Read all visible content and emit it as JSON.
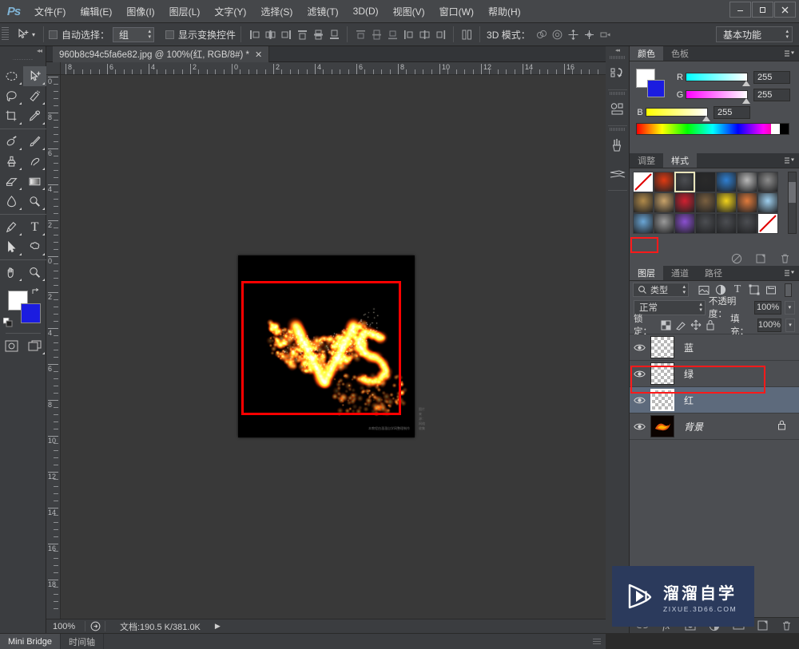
{
  "app": {
    "logo": "Ps",
    "menus": [
      {
        "label": "文件(F)"
      },
      {
        "label": "编辑(E)"
      },
      {
        "label": "图像(I)"
      },
      {
        "label": "图层(L)"
      },
      {
        "label": "文字(Y)"
      },
      {
        "label": "选择(S)"
      },
      {
        "label": "滤镜(T)"
      },
      {
        "label": "3D(D)"
      },
      {
        "label": "视图(V)"
      },
      {
        "label": "窗口(W)"
      },
      {
        "label": "帮助(H)"
      }
    ],
    "window_controls": {
      "minimize": "—",
      "maximize": "❐",
      "close": "✕"
    }
  },
  "options_bar": {
    "tool_icon": "move-tool-icon",
    "auto_select_label": "自动选择：",
    "auto_select_value": "组",
    "show_transform_label": "显示变换控件",
    "mode_3d_label": "3D 模式：",
    "workspace_value": "基本功能"
  },
  "toolbar": {
    "tools": [
      {
        "name": "marquee-tool",
        "glyph": "marquee"
      },
      {
        "name": "move-tool",
        "glyph": "move",
        "active": true
      },
      {
        "name": "lasso-tool",
        "glyph": "lasso"
      },
      {
        "name": "quick-selection-tool",
        "glyph": "quickselect"
      },
      {
        "name": "crop-tool",
        "glyph": "crop"
      },
      {
        "name": "eyedropper-tool",
        "glyph": "eyedropper"
      },
      {
        "name": "healing-brush-tool",
        "glyph": "heal"
      },
      {
        "name": "brush-tool",
        "glyph": "brush"
      },
      {
        "name": "clone-stamp-tool",
        "glyph": "stamp"
      },
      {
        "name": "history-brush-tool",
        "glyph": "historybrush"
      },
      {
        "name": "eraser-tool",
        "glyph": "eraser"
      },
      {
        "name": "gradient-tool",
        "glyph": "gradient"
      },
      {
        "name": "blur-tool",
        "glyph": "blur"
      },
      {
        "name": "dodge-tool",
        "glyph": "dodge"
      },
      {
        "name": "pen-tool",
        "glyph": "pen"
      },
      {
        "name": "type-tool",
        "glyph": "type"
      },
      {
        "name": "path-selection-tool",
        "glyph": "pathselect"
      },
      {
        "name": "shape-tool",
        "glyph": "shape"
      },
      {
        "name": "hand-tool",
        "glyph": "hand"
      },
      {
        "name": "zoom-tool",
        "glyph": "zoom"
      }
    ],
    "foreground_color": "#ffffff",
    "background_color": "#1b1ce0",
    "quick_mask_name": "quick-mask-button",
    "screen_mode_name": "screen-mode-button"
  },
  "document": {
    "tab_title": "960b8c94c5fa6e82.jpg @ 100%(红, RGB/8#) *",
    "close_glyph": "✕",
    "zoom_level": "100%",
    "ruler_h_labels": [
      "8",
      "6",
      "4",
      "2",
      "0",
      "2",
      "4",
      "6",
      "8",
      "10",
      "12",
      "14",
      "16"
    ],
    "ruler_v_labels": [
      "0",
      "8",
      "6",
      "4",
      "2",
      "0",
      "2",
      "4",
      "6",
      "8",
      "10",
      "12",
      "14",
      "16",
      "18"
    ],
    "credit_left": "图片来源：网络收集",
    "credit_right": "本教程由溜溜自学网整理制作"
  },
  "status_bar": {
    "zoom": "100%",
    "doc_label": "文档:190.5 K/381.0K",
    "arrow_glyph": "▶"
  },
  "bottom_tabs": [
    {
      "label": "Mini Bridge",
      "active": true
    },
    {
      "label": "时间轴",
      "active": false
    }
  ],
  "mini_dock": [
    {
      "name": "history-panel-icon"
    },
    {
      "name": "actions-panel-icon"
    },
    {
      "name": "brush-panel-icon"
    },
    {
      "name": "brush-presets-panel-icon"
    }
  ],
  "color_panel": {
    "tabs": [
      {
        "label": "颜色",
        "active": true
      },
      {
        "label": "色板",
        "active": false
      }
    ],
    "sliders": [
      {
        "label": "R",
        "value": "255"
      },
      {
        "label": "G",
        "value": "255"
      },
      {
        "label": "B",
        "value": "255"
      }
    ],
    "foreground": "#ffffff",
    "background": "#1b1ce0"
  },
  "styles_panel": {
    "tabs": [
      {
        "label": "调整",
        "active": false
      },
      {
        "label": "样式",
        "active": true
      }
    ],
    "swatches": [
      {
        "name": "style-none",
        "color": "none",
        "selected": false
      },
      {
        "name": "style-red-glow",
        "color": "#e03a12",
        "selected": false
      },
      {
        "name": "style-beveled",
        "color": "#4c4e52",
        "selected": true
      },
      {
        "name": "style-dark-metal",
        "color": "#2a2a2a",
        "selected": false
      },
      {
        "name": "style-blue-sky",
        "color": "#2f7fd1",
        "selected": false
      },
      {
        "name": "style-grey",
        "color": "#b9b9b9",
        "selected": false
      },
      {
        "name": "style-grey-glow",
        "color": "#8c8c8c",
        "selected": false
      },
      {
        "name": "style-tan",
        "color": "#b08a4a",
        "selected": false
      },
      {
        "name": "style-sand",
        "color": "#c8a269",
        "selected": false
      },
      {
        "name": "style-red-stripes",
        "color": "#d02030",
        "selected": false
      },
      {
        "name": "style-confetti",
        "color": "#7a6040",
        "selected": false
      },
      {
        "name": "style-yellow",
        "color": "#f2d31b",
        "selected": false
      },
      {
        "name": "style-sunset",
        "color": "#e07b3c",
        "selected": false
      },
      {
        "name": "style-ice",
        "color": "#9fd0ef",
        "selected": false
      },
      {
        "name": "style-beach",
        "color": "#6aa6d6",
        "selected": false
      },
      {
        "name": "style-noise",
        "color": "#9a9a9a",
        "selected": false
      },
      {
        "name": "style-purple",
        "color": "#8a4fd0",
        "selected": false
      },
      {
        "name": "style-empty-1",
        "color": "#4c4e52",
        "selected": false
      },
      {
        "name": "style-empty-2",
        "color": "#4c4e52",
        "selected": false
      },
      {
        "name": "style-empty-3",
        "color": "#4c4e52",
        "selected": false
      },
      {
        "name": "style-clear",
        "color": "none",
        "selected": false
      }
    ],
    "footer_icons": [
      {
        "name": "clear-style-icon",
        "glyph": "⊘"
      },
      {
        "name": "new-style-icon",
        "glyph": "▣"
      },
      {
        "name": "delete-style-icon",
        "glyph": "🗑"
      }
    ]
  },
  "layers_panel": {
    "tabs": [
      {
        "label": "图层",
        "active": true,
        "highlighted": true
      },
      {
        "label": "通道",
        "active": false
      },
      {
        "label": "路径",
        "active": false
      }
    ],
    "filter_label": "类型",
    "filter_icons": [
      "pixel-filter-icon",
      "adjustment-filter-icon",
      "type-filter-icon",
      "shape-filter-icon",
      "smart-object-filter-icon"
    ],
    "blend_mode": "正常",
    "opacity_label": "不透明度：",
    "opacity_value": "100%",
    "lock_label": "锁定：",
    "lock_icons": [
      "lock-transparent-icon",
      "lock-image-icon",
      "lock-position-icon",
      "lock-all-icon"
    ],
    "fill_label": "填充：",
    "fill_value": "100%",
    "layers": [
      {
        "name": "蓝",
        "visible": true,
        "selected": false,
        "locked": false,
        "type": "empty"
      },
      {
        "name": "绿",
        "visible": true,
        "selected": false,
        "locked": false,
        "type": "empty"
      },
      {
        "name": "红",
        "visible": true,
        "selected": true,
        "locked": false,
        "type": "empty"
      },
      {
        "name": "背景",
        "visible": true,
        "selected": false,
        "locked": true,
        "type": "image"
      }
    ],
    "footer_icons": [
      {
        "name": "link-layers-icon",
        "glyph": "🔗"
      },
      {
        "name": "layer-style-icon",
        "glyph": "fx"
      },
      {
        "name": "layer-mask-icon",
        "glyph": "▣"
      },
      {
        "name": "adjustment-layer-icon",
        "glyph": "◐"
      },
      {
        "name": "new-group-icon",
        "glyph": "📁"
      },
      {
        "name": "new-layer-icon",
        "glyph": "❐"
      },
      {
        "name": "delete-layer-icon",
        "glyph": "🗑"
      }
    ]
  },
  "watermark": {
    "title": "溜溜自学",
    "url": "ZIXUE.3D66.COM",
    "background": "#2b3a5c"
  },
  "annotations": {
    "layers_tab_box": "图层",
    "red_layer_box": "红",
    "selection_color": "#ff0000"
  }
}
